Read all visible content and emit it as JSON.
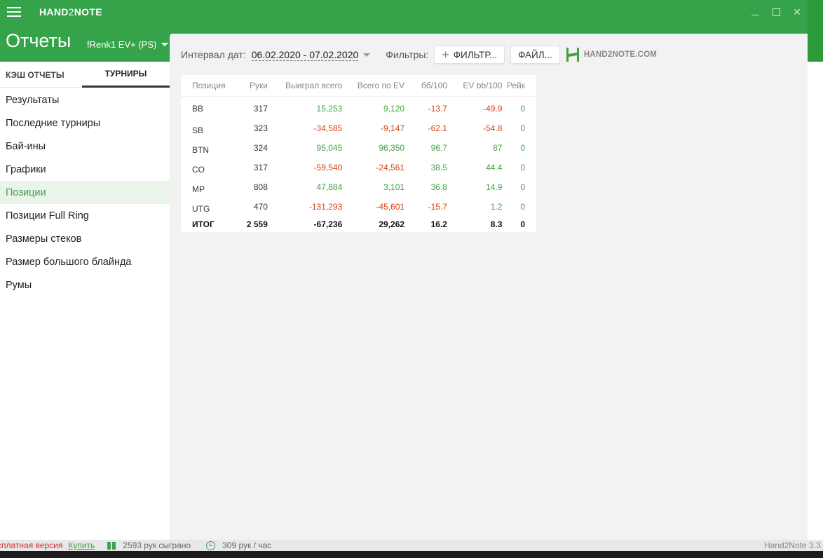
{
  "app": {
    "brand_a": "HAND",
    "brand_b": "2",
    "brand_c": "NOTE"
  },
  "header": {
    "title": "Отчеты",
    "player": "fRenk1 EV+ (PS)"
  },
  "sidebar": {
    "tabs": {
      "cash": "КЭШ ОТЧЕТЫ",
      "tournaments": "ТУРНИРЫ"
    },
    "items": [
      {
        "label": "Результаты"
      },
      {
        "label": "Последние турниры"
      },
      {
        "label": "Бай-ины"
      },
      {
        "label": "Графики"
      },
      {
        "label": "Позиции"
      },
      {
        "label": "Позиции Full Ring"
      },
      {
        "label": "Размеры стеков"
      },
      {
        "label": "Размер большого блайнда"
      },
      {
        "label": "Румы"
      }
    ]
  },
  "toolbar": {
    "date_label": "Интервал дат:",
    "date_value": "06.02.2020 - 07.02.2020",
    "filters_label": "Фильтры:",
    "filter_button": "ФИЛЬТР...",
    "file_button": "ФАЙЛ...",
    "logo_text": "HAND2NOTE.COM"
  },
  "table": {
    "headers": [
      "Позиция",
      "Руки",
      "Выиграл всего",
      "Всего по EV",
      "бб/100",
      "EV bb/100",
      "Рейк"
    ],
    "rows": [
      {
        "pos": "BB",
        "hands": "317",
        "won": "15,253",
        "ev": "9,120",
        "bb": "-13.7",
        "evbb": "-49.9",
        "rake": "0"
      },
      {
        "pos": "SB",
        "hands": "323",
        "won": "-34,585",
        "ev": "-9,147",
        "bb": "-62.1",
        "evbb": "-54.8",
        "rake": "0"
      },
      {
        "pos": "BTN",
        "hands": "324",
        "won": "95,045",
        "ev": "96,350",
        "bb": "96.7",
        "evbb": "87",
        "rake": "0"
      },
      {
        "pos": "CO",
        "hands": "317",
        "won": "-59,540",
        "ev": "-24,561",
        "bb": "38.5",
        "evbb": "44.4",
        "rake": "0"
      },
      {
        "pos": "MP",
        "hands": "808",
        "won": "47,884",
        "ev": "3,101",
        "bb": "36.8",
        "evbb": "14.9",
        "rake": "0"
      },
      {
        "pos": "UTG",
        "hands": "470",
        "won": "-131,293",
        "ev": "-45,601",
        "bb": "-15.7",
        "evbb": "1.2",
        "rake": "0"
      }
    ],
    "total": {
      "pos": "ИТОГ",
      "hands": "2 559",
      "won": "-67,236",
      "ev": "29,262",
      "bb": "16.2",
      "evbb": "8.3",
      "rake": "0"
    }
  },
  "status": {
    "free_version": "сплатная версия",
    "buy": "Купить",
    "hands_played": "2593 рук сыграно",
    "rate": "309 рук / час",
    "version": "Hand2Note 3.3."
  },
  "colors": {
    "brand_green": "#34a34a",
    "positive": "#43a047",
    "negative": "#d84315"
  }
}
